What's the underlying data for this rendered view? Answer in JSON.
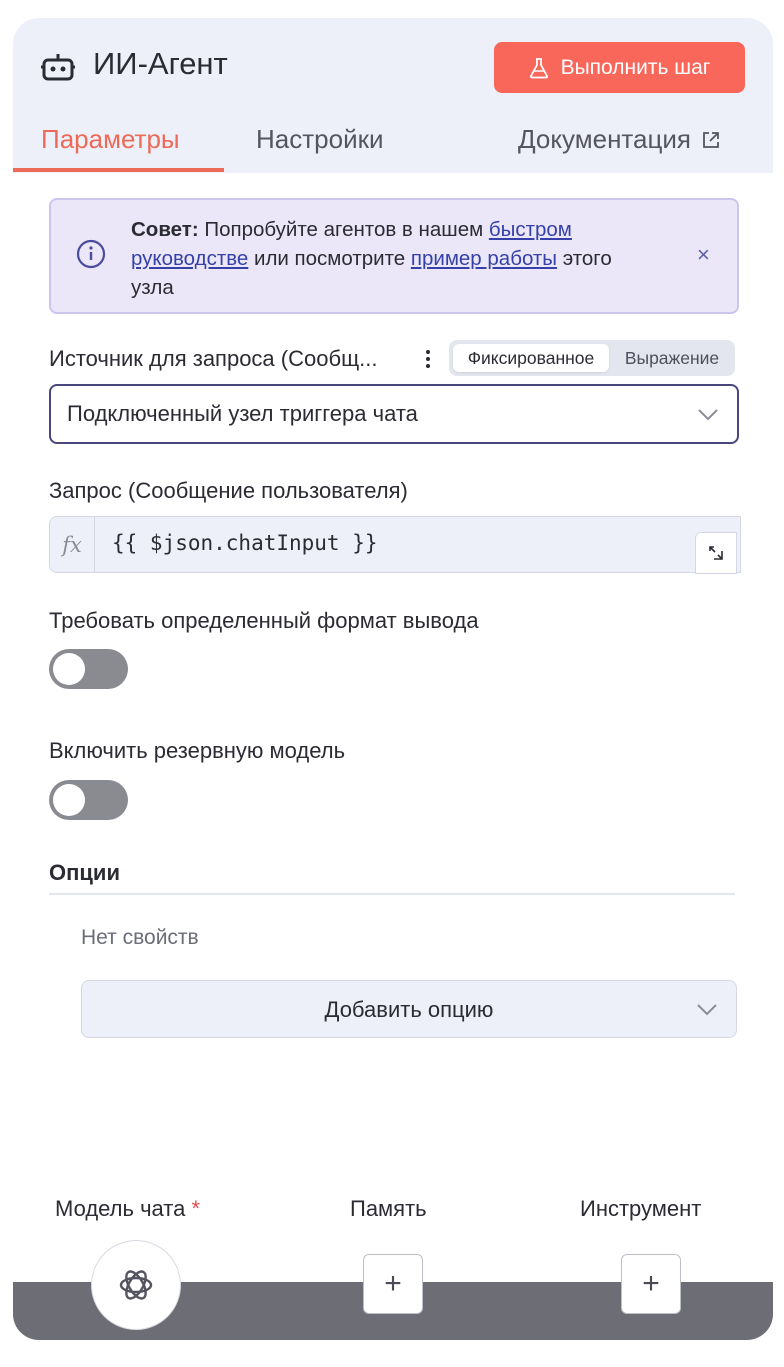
{
  "header": {
    "title": "ИИ-Агент",
    "run_button": "Выполнить шаг"
  },
  "tabs": [
    {
      "label": "Параметры",
      "active": true
    },
    {
      "label": "Настройки",
      "active": false
    },
    {
      "label": "Документация",
      "active": false
    }
  ],
  "tip": {
    "bold": "Совет:",
    "text1": " Попробуйте агентов в нашем ",
    "link1a": "быстром",
    "link1b": "руководстве",
    "text2": " или посмотрите ",
    "link2": "пример работы",
    "text3": " этого узла"
  },
  "prompt_source": {
    "label": "Источник для запроса (Сообщ...",
    "mode_fixed": "Фиксированное",
    "mode_expression": "Выражение",
    "value": "Подключенный узел триггера чата"
  },
  "prompt": {
    "label": "Запрос (Сообщение пользователя)",
    "fx": "fx",
    "expression": "{{ $json.chatInput }}"
  },
  "require_format": {
    "label": "Требовать определенный формат вывода",
    "enabled": false
  },
  "fallback_model": {
    "label": "Включить резервную модель",
    "enabled": false
  },
  "options": {
    "title": "Опции",
    "empty": "Нет свойств",
    "add_button": "Добавить опцию"
  },
  "connectors": {
    "chat_model": "Модель чата",
    "required_mark": "*",
    "memory": "Память",
    "tool": "Инструмент",
    "plus": "+"
  },
  "colors": {
    "accent": "#ec6a57",
    "run_button": "#f8675a",
    "link": "#3541a8",
    "tip_bg": "#ebe7f8"
  }
}
